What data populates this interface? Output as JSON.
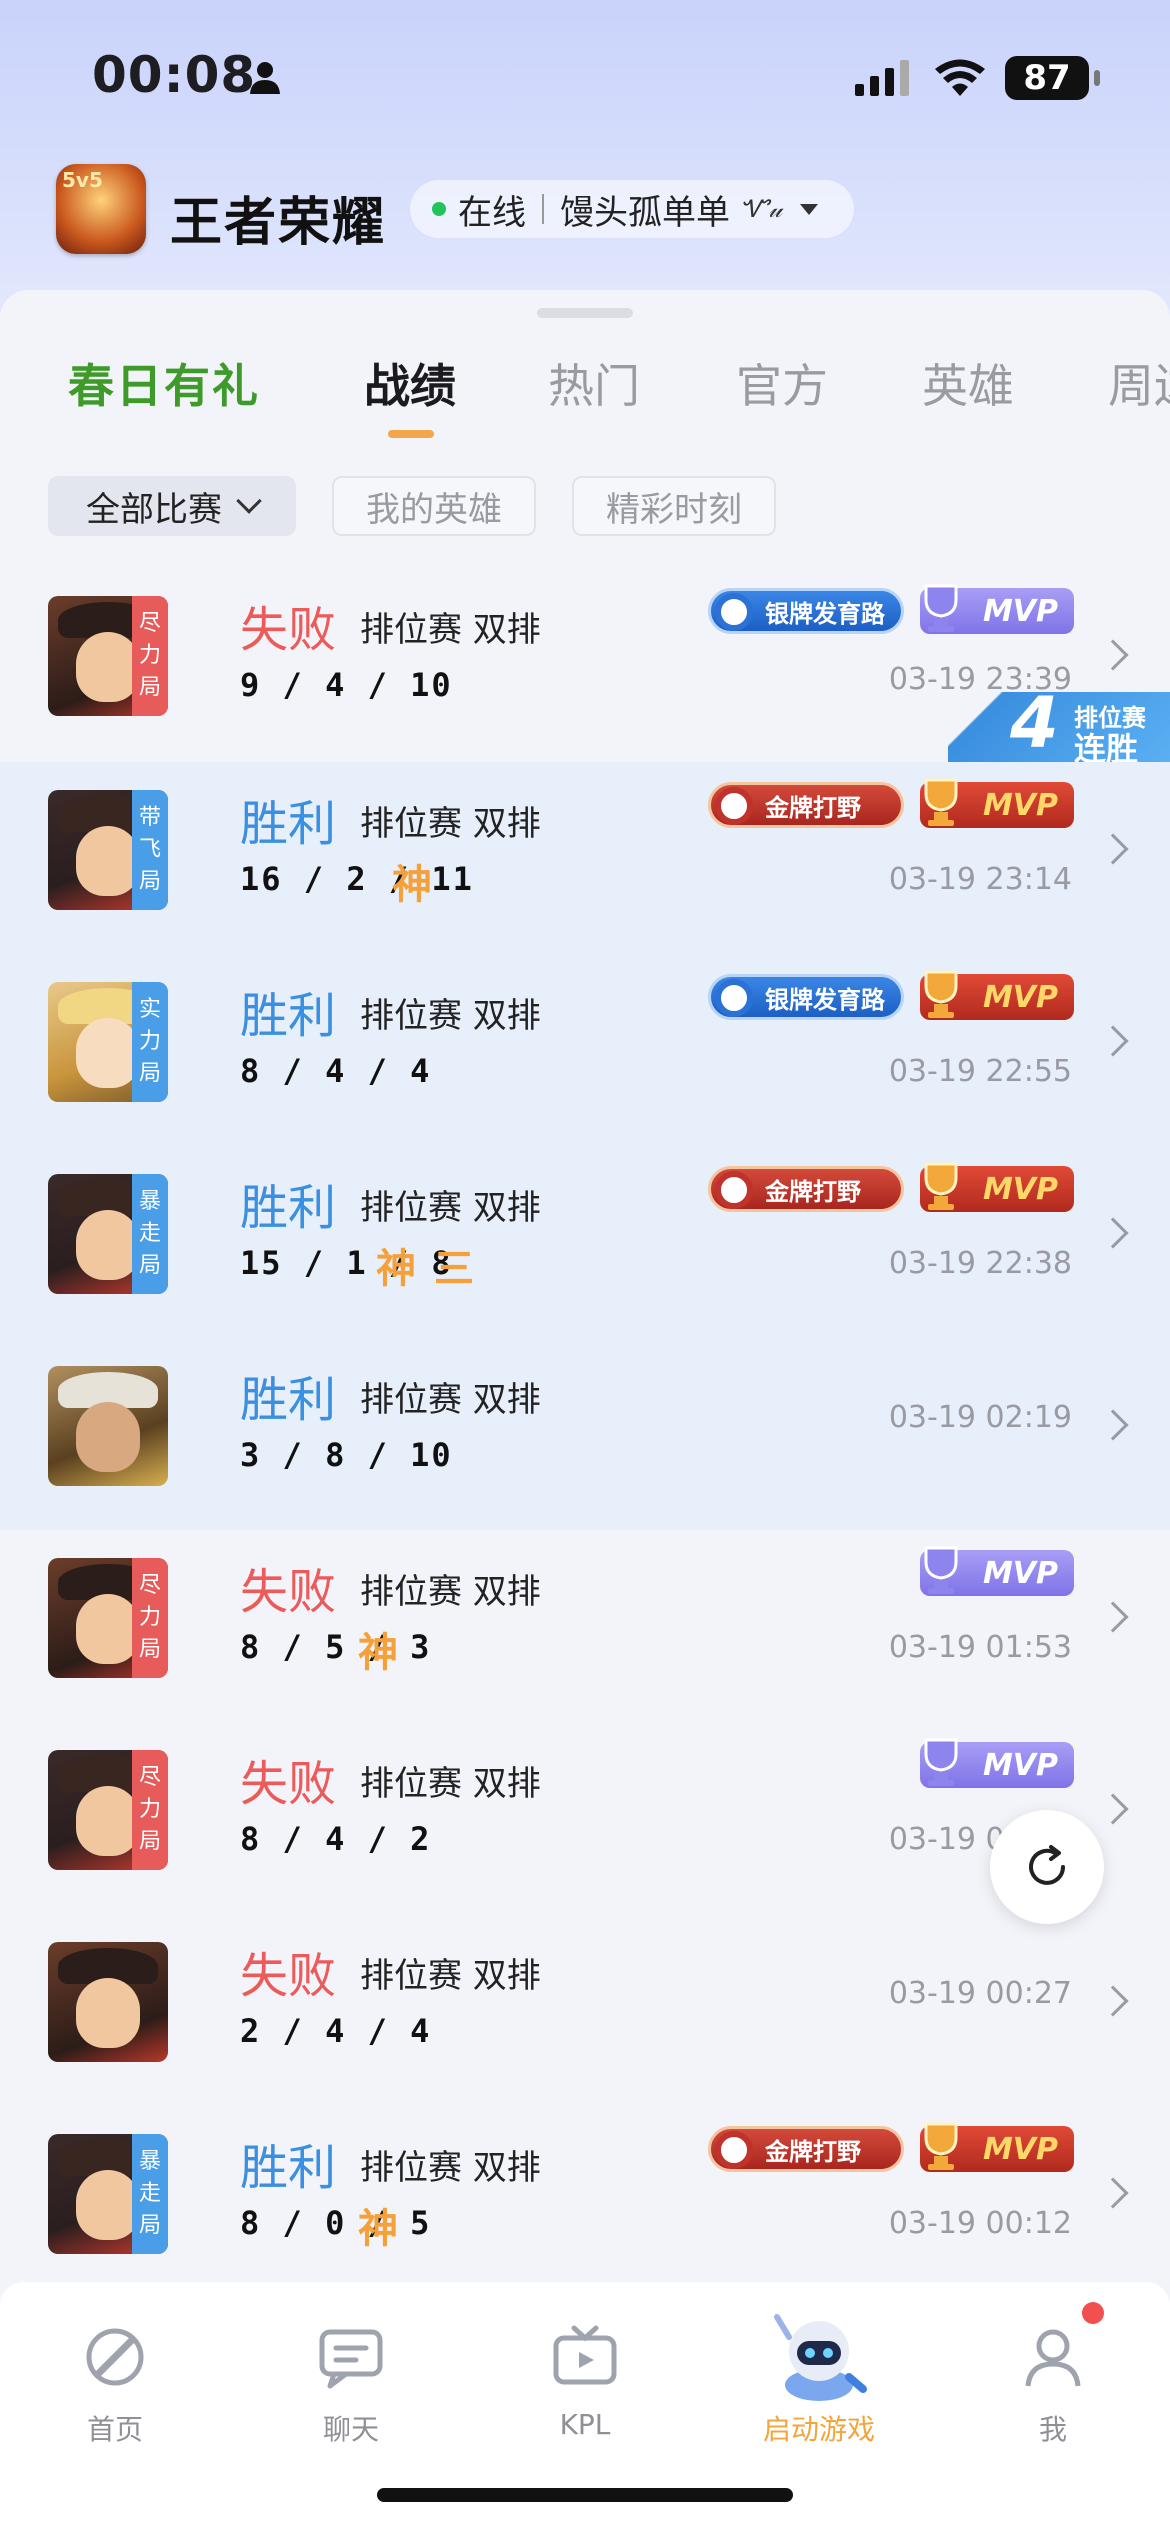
{
  "status_bar": {
    "time": "00:08",
    "battery": "87"
  },
  "header": {
    "app_title": "王者荣耀",
    "online_status": "在线",
    "username": "馒头孤单单",
    "signature_mark": "Ꮙ𝓊"
  },
  "tabs": [
    {
      "label": "春日有礼"
    },
    {
      "label": "战绩"
    },
    {
      "label": "热门"
    },
    {
      "label": "官方"
    },
    {
      "label": "英雄"
    },
    {
      "label": "周边"
    }
  ],
  "filters": {
    "all_matches": "全部比赛",
    "my_heroes": "我的英雄",
    "highlights": "精彩时刻"
  },
  "streak": {
    "number": "4",
    "top": "排位赛",
    "bottom": "连胜"
  },
  "matches": [
    {
      "result": "失败",
      "mode": "排位赛 双排",
      "kda": "9 / 4 / 10",
      "tag": "尽力局",
      "time": "03-19 23:39",
      "role": "银牌发育路",
      "mvp": "MVP"
    },
    {
      "result": "胜利",
      "mode": "排位赛 双排",
      "kda": "16 / 2 / 11",
      "god": "神",
      "tag": "带飞局",
      "time": "03-19 23:14",
      "role": "金牌打野",
      "mvp": "MVP"
    },
    {
      "result": "胜利",
      "mode": "排位赛 双排",
      "kda": "8 / 4 / 4",
      "tag": "实力局",
      "time": "03-19 22:55",
      "role": "银牌发育路",
      "mvp": "MVP"
    },
    {
      "result": "胜利",
      "mode": "排位赛 双排",
      "kda": "15 / 1 / 8",
      "god": "神",
      "god2": "三",
      "tag": "暴走局",
      "time": "03-19 22:38",
      "role": "金牌打野",
      "mvp": "MVP"
    },
    {
      "result": "胜利",
      "mode": "排位赛 双排",
      "kda": "3 / 8 / 10",
      "time": "03-19 02:19"
    },
    {
      "result": "失败",
      "mode": "排位赛 双排",
      "kda": "8 / 5 / 3",
      "god": "神",
      "tag": "尽力局",
      "time": "03-19 01:53",
      "mvp": "MVP"
    },
    {
      "result": "失败",
      "mode": "排位赛 双排",
      "kda": "8 / 4 / 2",
      "tag": "尽力局",
      "time": "03-19 01:34",
      "mvp": "MVP"
    },
    {
      "result": "失败",
      "mode": "排位赛 双排",
      "kda": "2 / 4 / 4",
      "time": "03-19 00:27"
    },
    {
      "result": "胜利",
      "mode": "排位赛 双排",
      "kda": "8 / 0 / 5",
      "god": "神",
      "tag": "暴走局",
      "time": "03-19 00:12",
      "role": "金牌打野",
      "mvp": "MVP"
    }
  ],
  "tabbar": [
    {
      "label": "首页"
    },
    {
      "label": "聊天"
    },
    {
      "label": "KPL"
    },
    {
      "label": "启动游戏"
    },
    {
      "label": "我"
    }
  ]
}
